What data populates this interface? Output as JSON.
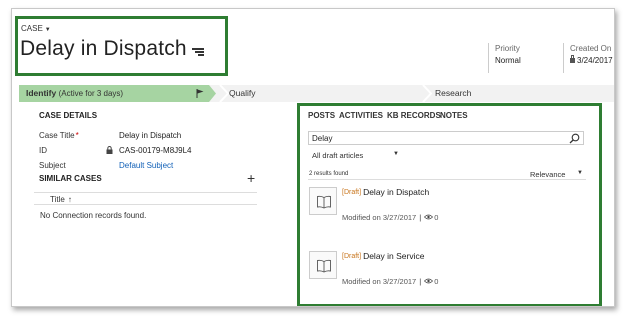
{
  "header": {
    "entity_label": "CASE",
    "title": "Delay in Dispatch",
    "priority_label": "Priority",
    "priority_value": "Normal",
    "created_label": "Created On",
    "created_value": "3/24/2017"
  },
  "process": {
    "stages": [
      {
        "name": "Identify",
        "status": "(Active for 3 days)"
      },
      {
        "name": "Qualify"
      },
      {
        "name": "Research"
      }
    ]
  },
  "case_details": {
    "section_title": "CASE DETAILS",
    "fields": [
      {
        "label": "Case Title",
        "value": "Delay in Dispatch"
      },
      {
        "label": "ID",
        "value": "CAS-00179-M8J9L4"
      },
      {
        "label": "Subject",
        "value": "Default Subject"
      }
    ]
  },
  "similar_cases": {
    "section_title": "SIMILAR CASES",
    "column_title": "Title",
    "empty_message": "No Connection records found."
  },
  "kb_panel": {
    "tabs": [
      "POSTS",
      "ACTIVITIES",
      "KB RECORDS",
      "NOTES"
    ],
    "search_value": "Delay",
    "filter_value": "All draft articles",
    "results_count": "2 results found",
    "sort_value": "Relevance",
    "items": [
      {
        "tag": "[Draft]",
        "title": "Delay in Dispatch",
        "modified": "Modified on 3/27/2017",
        "views": "0"
      },
      {
        "tag": "[Draft]",
        "title": "Delay in Service",
        "modified": "Modified on 3/27/2017",
        "views": "0"
      }
    ]
  },
  "colors": {
    "highlight_border": "#2e7d32",
    "active_stage": "#a6d4a2",
    "link": "#1160b7",
    "draft_tag": "#c8741b"
  }
}
